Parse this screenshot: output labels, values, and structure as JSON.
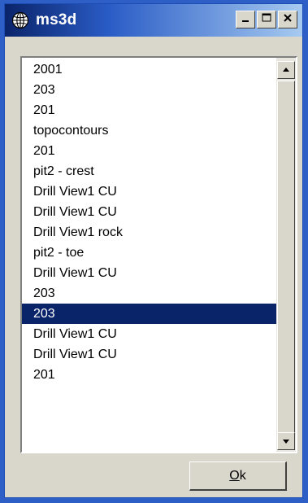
{
  "window": {
    "title": "ms3d",
    "icon": "globe-icon",
    "controls": [
      "minimize-icon",
      "maximize-icon",
      "close-icon"
    ]
  },
  "list": {
    "items": [
      "2001",
      "203",
      "201",
      "topocontours",
      "201",
      "pit2 - crest",
      "Drill View1 CU",
      "Drill View1 CU",
      "Drill View1 rock",
      "pit2 - toe",
      "Drill View1 CU",
      "203",
      "203",
      "Drill View1 CU",
      "Drill View1 CU",
      "201"
    ],
    "selected_index": 12
  },
  "buttons": {
    "ok_label": "Ok",
    "ok_mnemonic": "O"
  },
  "colors": {
    "selection": "#0a246a",
    "title_gradient_start": "#0a246a",
    "title_gradient_end": "#a6caf0",
    "face": "#d9d6cc"
  }
}
